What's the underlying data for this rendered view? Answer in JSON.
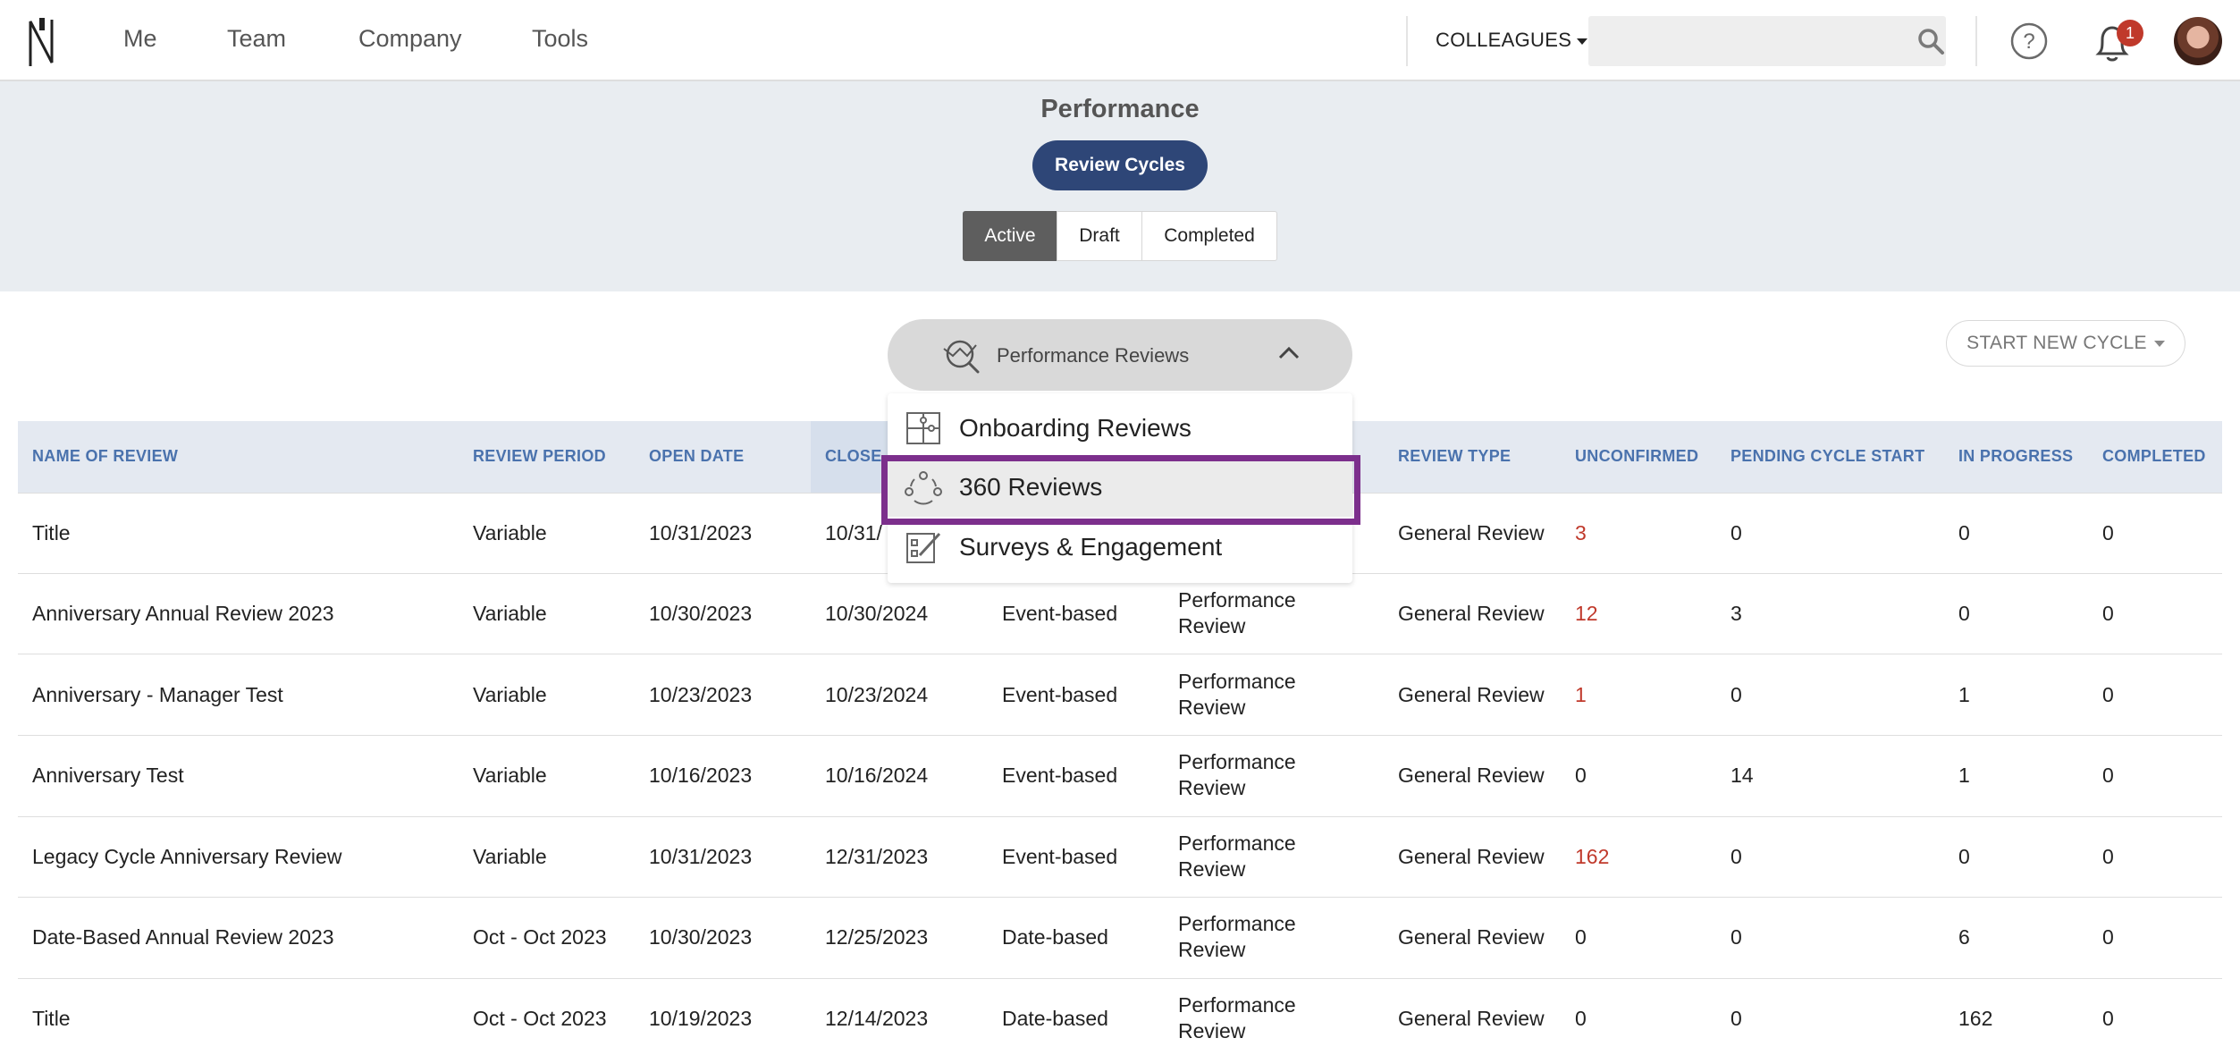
{
  "nav": {
    "items": [
      "Me",
      "Team",
      "Company",
      "Tools"
    ],
    "colleagues": "COLLEAGUES",
    "search_placeholder": "",
    "notifications": "1"
  },
  "header": {
    "title": "Performance",
    "review_cycles": "Review Cycles",
    "tabs": [
      "Active",
      "Draft",
      "Completed"
    ],
    "active_tab": "Active"
  },
  "toolbar": {
    "category_label": "Performance Reviews",
    "start_new_cycle": "START NEW CYCLE"
  },
  "dropdown": {
    "items": [
      "Onboarding Reviews",
      "360 Reviews",
      "Surveys & Engagement"
    ],
    "highlighted": "360 Reviews"
  },
  "table": {
    "columns": [
      "NAME OF REVIEW",
      "REVIEW PERIOD",
      "OPEN DATE",
      "CLOSE",
      "REVIEW TYPE",
      "UNCONFIRMED",
      "PENDING CYCLE START",
      "IN PROGRESS",
      "COMPLETED"
    ],
    "rows": [
      {
        "name": "Title",
        "period": "Variable",
        "open": "10/31/2023",
        "close": "10/31/",
        "schedule": "",
        "category": "",
        "type": "General Review",
        "unconfirmed": "3",
        "pending": "0",
        "in_progress": "0",
        "completed": "0"
      },
      {
        "name": "Anniversary Annual Review 2023",
        "period": "Variable",
        "open": "10/30/2023",
        "close": "10/30/2024",
        "schedule": "Event-based",
        "category": "Performance Review",
        "type": "General Review",
        "unconfirmed": "12",
        "pending": "3",
        "in_progress": "0",
        "completed": "0"
      },
      {
        "name": "Anniversary - Manager Test",
        "period": "Variable",
        "open": "10/23/2023",
        "close": "10/23/2024",
        "schedule": "Event-based",
        "category": "Performance Review",
        "type": "General Review",
        "unconfirmed": "1",
        "pending": "0",
        "in_progress": "1",
        "completed": "0"
      },
      {
        "name": "Anniversary Test",
        "period": "Variable",
        "open": "10/16/2023",
        "close": "10/16/2024",
        "schedule": "Event-based",
        "category": "Performance Review",
        "type": "General Review",
        "unconfirmed": "0",
        "pending": "14",
        "in_progress": "1",
        "completed": "0"
      },
      {
        "name": "Legacy Cycle Anniversary Review",
        "period": "Variable",
        "open": "10/31/2023",
        "close": "12/31/2023",
        "schedule": "Event-based",
        "category": "Performance Review",
        "type": "General Review",
        "unconfirmed": "162",
        "pending": "0",
        "in_progress": "0",
        "completed": "0"
      },
      {
        "name": "Date-Based Annual Review 2023",
        "period": "Oct - Oct 2023",
        "open": "10/30/2023",
        "close": "12/25/2023",
        "schedule": "Date-based",
        "category": "Performance Review",
        "type": "General Review",
        "unconfirmed": "0",
        "pending": "0",
        "in_progress": "6",
        "completed": "0"
      },
      {
        "name": "Title",
        "period": "Oct - Oct 2023",
        "open": "10/19/2023",
        "close": "12/14/2023",
        "schedule": "Date-based",
        "category": "Performance Review",
        "type": "General Review",
        "unconfirmed": "0",
        "pending": "0",
        "in_progress": "162",
        "completed": "0"
      }
    ]
  },
  "colors": {
    "brand": "#2e4677",
    "header_text": "#4a72ad",
    "alert": "#c0392b",
    "highlight": "#7c2f8c"
  }
}
